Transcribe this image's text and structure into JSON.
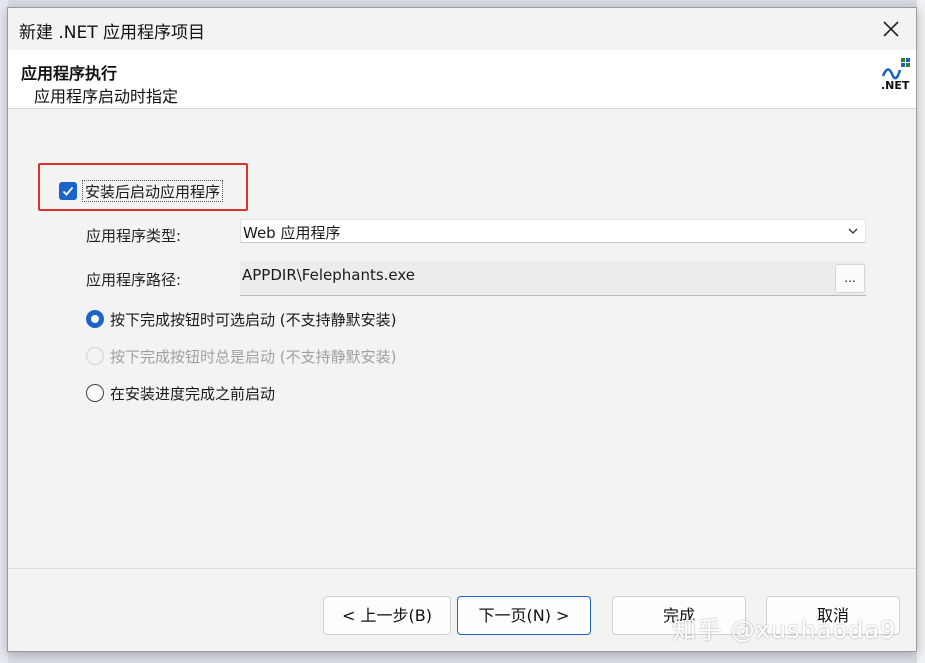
{
  "window": {
    "title": "新建 .NET 应用程序项目"
  },
  "header": {
    "title": "应用程序执行",
    "subtitle": "应用程序启动时指定",
    "logo_text": ".NET"
  },
  "launch_after_install": {
    "label": "安装后启动应用程序",
    "checked": true
  },
  "app_type": {
    "label": "应用程序类型:",
    "value": "Web 应用程序"
  },
  "app_path": {
    "label": "应用程序路径:",
    "value": "APPDIR\\Felephants.exe",
    "browse_label": "..."
  },
  "launch_options": [
    {
      "label": "按下完成按钮时可选启动 (不支持静默安装)",
      "state": "selected"
    },
    {
      "label": "按下完成按钮时总是启动 (不支持静默安装)",
      "state": "disabled"
    },
    {
      "label": "在安装进度完成之前启动",
      "state": "normal"
    }
  ],
  "buttons": {
    "back": "< 上一步(B)",
    "next": "下一页(N) >",
    "finish": "完成",
    "cancel": "取消"
  },
  "watermark": "知乎 @xushaoda9",
  "colors": {
    "accent": "#1b64c8",
    "highlight_border": "#d9342b"
  }
}
